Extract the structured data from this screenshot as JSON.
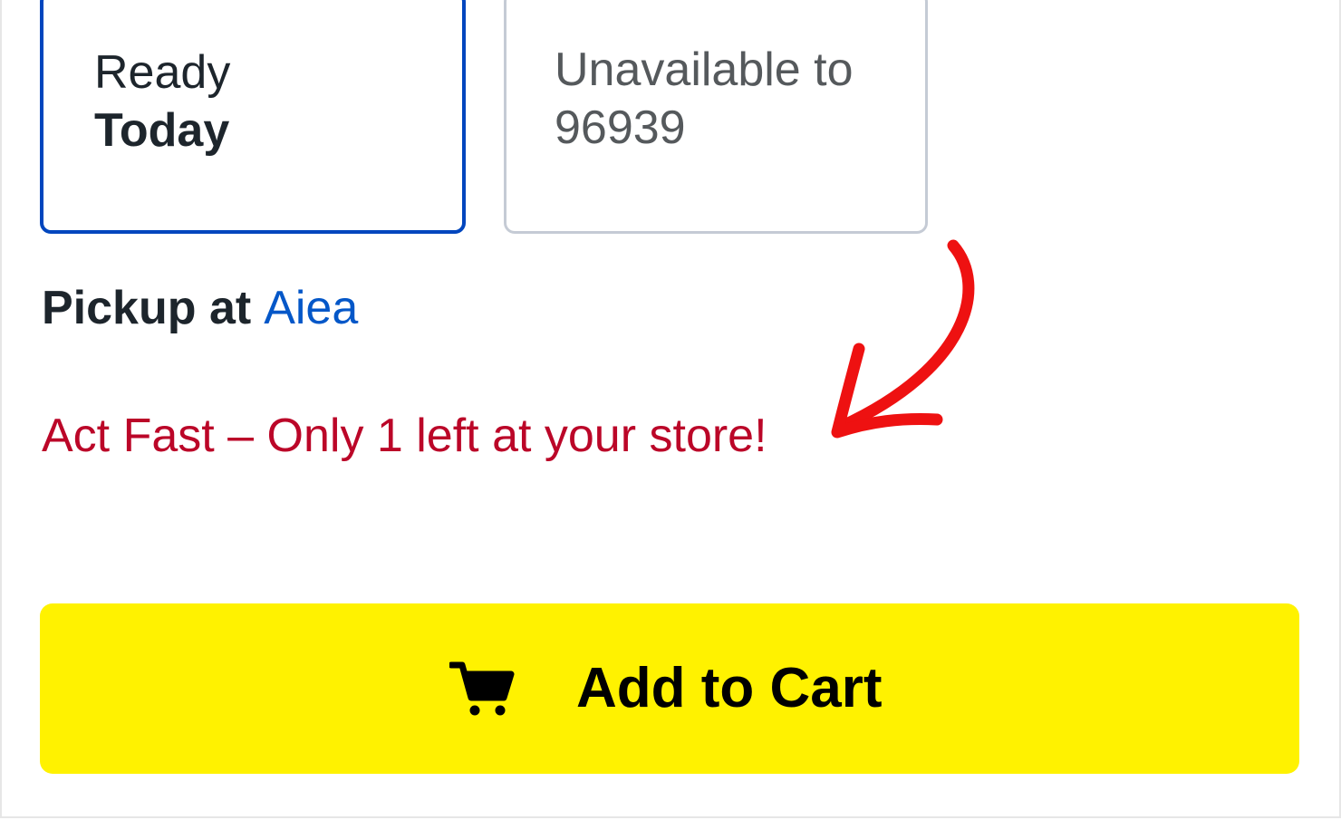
{
  "fulfillment_options": {
    "pickup": {
      "line1": "Ready",
      "line2": "Today",
      "selected": true
    },
    "shipping": {
      "line1": "Unavailable to",
      "line2": "96939",
      "selected": false
    }
  },
  "pickup": {
    "label": "Pickup at",
    "store_name": "Aiea"
  },
  "urgency_message": "Act Fast – Only 1 left at your store!",
  "add_to_cart": {
    "label": "Add to Cart",
    "icon": "shopping-cart-icon"
  },
  "annotation": {
    "icon": "curved-arrow-icon",
    "color": "#ee1111"
  },
  "colors": {
    "selected_border": "#0046be",
    "link": "#0457c8",
    "urgency": "#bb0628",
    "cart_button": "#fff200"
  }
}
